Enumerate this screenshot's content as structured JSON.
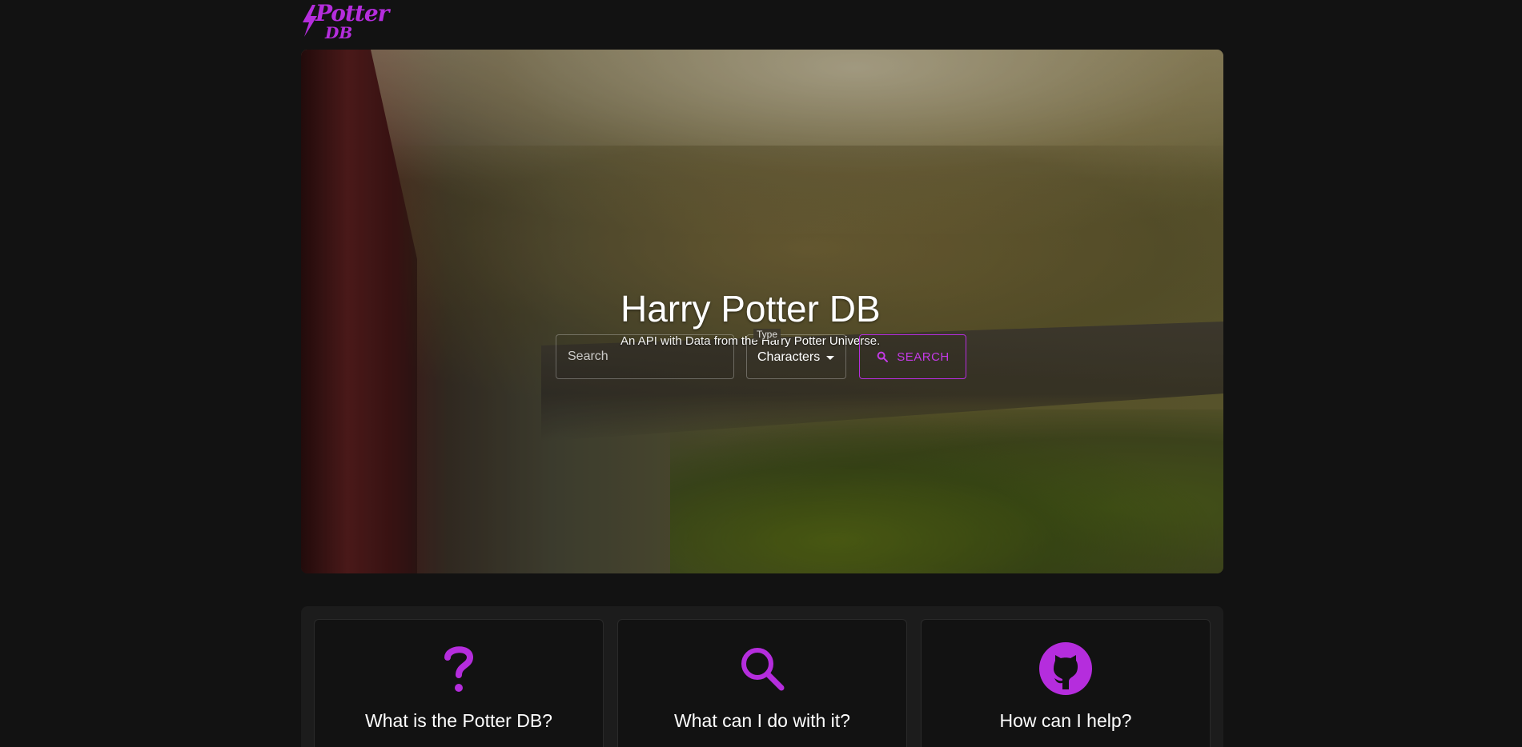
{
  "header": {
    "logo_line1": "Potter",
    "logo_line2": "DB"
  },
  "hero": {
    "title": "Harry Potter DB",
    "subtitle": "An API with Data from the Harry Potter Universe.",
    "search": {
      "placeholder": "Search",
      "value": ""
    },
    "type_select": {
      "label": "Type",
      "value": "Characters"
    },
    "search_button_label": "SEARCH"
  },
  "features": {
    "cards": [
      {
        "icon": "question-icon",
        "title": "What is the Potter DB?"
      },
      {
        "icon": "search-icon",
        "title": "What can I do with it?"
      },
      {
        "icon": "github-icon",
        "title": "How can I help?"
      }
    ]
  },
  "colors": {
    "background": "#121212",
    "accent": "#b52ddd",
    "panel": "#1c1c1c"
  }
}
